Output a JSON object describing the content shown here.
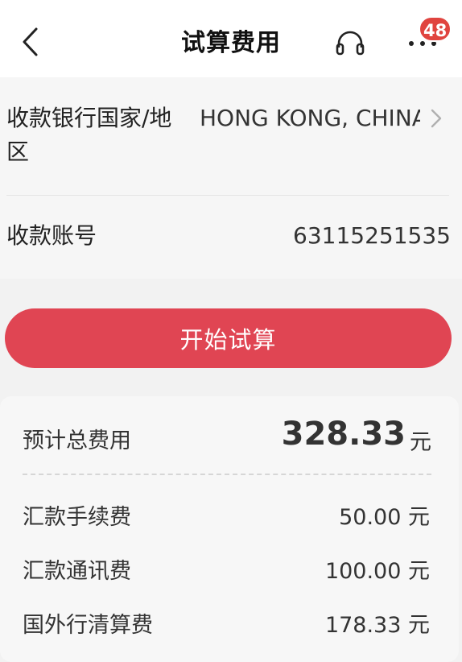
{
  "header": {
    "title": "试算费用",
    "badge_count": "48"
  },
  "info": {
    "bank_country_label_line1": "收款银行国家/地",
    "bank_country_label_line2": "区",
    "bank_country_value": "HONG KONG, CHINA",
    "account_label": "收款账号",
    "account_value": "63115251535"
  },
  "actions": {
    "calculate_label": "开始试算"
  },
  "fees": {
    "total_label": "预计总费用",
    "total_amount": "328.33",
    "currency_unit": "元",
    "items": [
      {
        "label": "汇款手续费",
        "amount": "50.00 元"
      },
      {
        "label": "汇款通讯费",
        "amount": "100.00 元"
      },
      {
        "label": "国外行清算费",
        "amount": "178.33 元"
      }
    ]
  },
  "colors": {
    "accent": "#e04553",
    "badge": "#e0443f"
  }
}
